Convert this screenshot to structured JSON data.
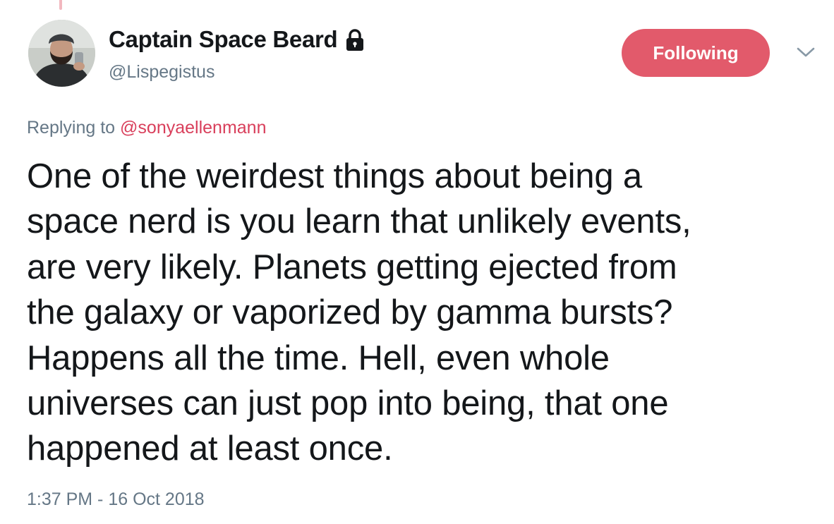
{
  "tweet": {
    "author": {
      "display_name": "Captain Space Beard",
      "handle": "@Lispegistus",
      "avatar_icon": "profile-photo",
      "protected_icon": "lock-icon"
    },
    "follow_button": {
      "label": "Following",
      "color": "#e25a6b"
    },
    "menu_icon": "chevron-down-icon",
    "reply": {
      "prefix": "Replying to",
      "mention": "@sonyaellenmann"
    },
    "text": "One of the weirdest things about being a\nspace nerd is you learn that unlikely events,\nare very likely. Planets getting ejected from\nthe galaxy or vaporized by gamma bursts?\nHappens all the time. Hell, even whole\nuniverses can just pop into being, that one\nhappened at least once.",
    "timestamp": "1:37 PM - 16 Oct 2018"
  },
  "colors": {
    "text_primary": "#14171a",
    "text_secondary": "#657786",
    "accent": "#d93f5b"
  }
}
